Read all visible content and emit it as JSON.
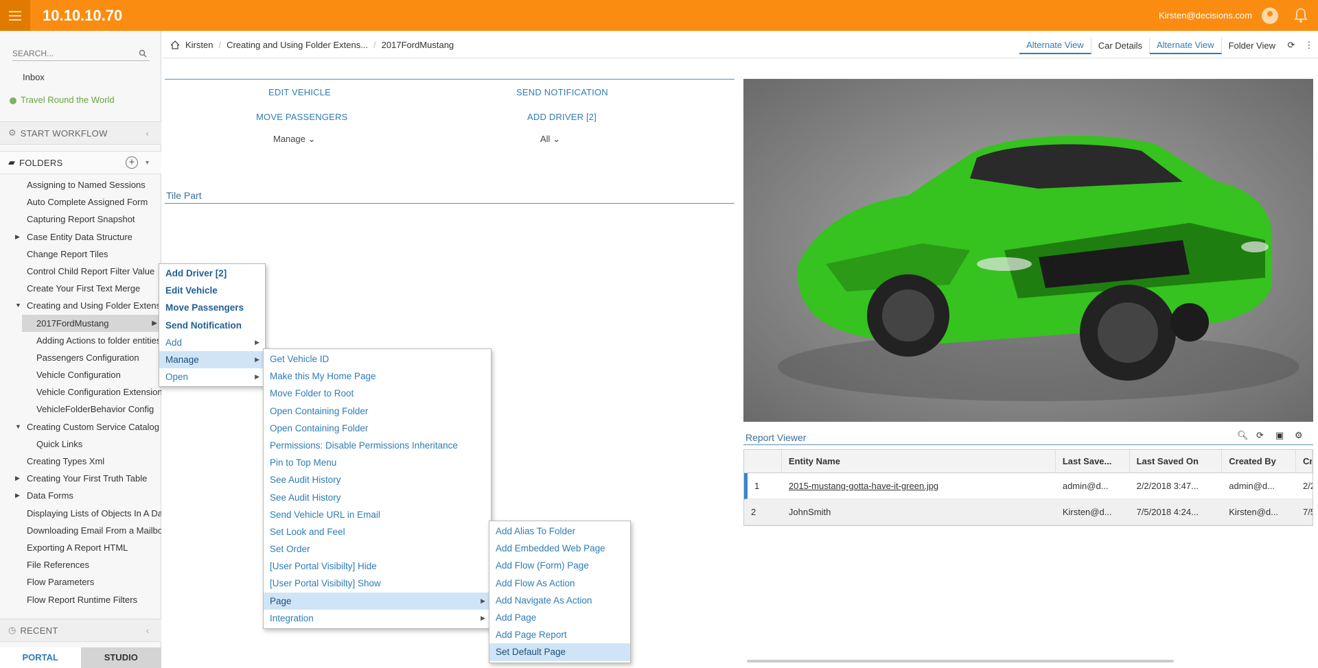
{
  "topbar": {
    "title": "10.10.10.70",
    "user": "Kirsten@decisions.com"
  },
  "sidebar": {
    "search_placeholder": "SEARCH...",
    "inbox": "Inbox",
    "travel": "Travel Round the World",
    "start_workflow": "START WORKFLOW",
    "folders": "FOLDERS",
    "tree": [
      {
        "label": "Assigning to Named Sessions",
        "indent": 0,
        "toggle": ""
      },
      {
        "label": "Auto Complete Assigned Form",
        "indent": 0,
        "toggle": ""
      },
      {
        "label": "Capturing Report Snapshot",
        "indent": 0,
        "toggle": ""
      },
      {
        "label": "Case Entity Data Structure",
        "indent": 0,
        "toggle": "▶"
      },
      {
        "label": "Change Report Tiles",
        "indent": 0,
        "toggle": ""
      },
      {
        "label": "Control Child Report Filter Value",
        "indent": 0,
        "toggle": ""
      },
      {
        "label": "Create Your First Text Merge",
        "indent": 0,
        "toggle": ""
      },
      {
        "label": "Creating and Using Folder Extensions",
        "indent": 0,
        "toggle": "▼"
      },
      {
        "label": "2017FordMustang",
        "indent": 1,
        "toggle": "",
        "selected": true
      },
      {
        "label": "Adding Actions to folder entities",
        "indent": 1,
        "toggle": ""
      },
      {
        "label": "Passengers Configuration",
        "indent": 1,
        "toggle": ""
      },
      {
        "label": "Vehicle Configuration",
        "indent": 1,
        "toggle": ""
      },
      {
        "label": "Vehicle Configuration Extension",
        "indent": 1,
        "toggle": ""
      },
      {
        "label": "VehicleFolderBehavior Config",
        "indent": 1,
        "toggle": ""
      },
      {
        "label": "Creating Custom Service Catalog",
        "indent": 0,
        "toggle": "▼"
      },
      {
        "label": "Quick Links",
        "indent": 1,
        "toggle": ""
      },
      {
        "label": "Creating Types Xml",
        "indent": 0,
        "toggle": ""
      },
      {
        "label": "Creating Your First Truth Table",
        "indent": 0,
        "toggle": "▶"
      },
      {
        "label": "Data Forms",
        "indent": 0,
        "toggle": "▶"
      },
      {
        "label": "Displaying Lists of Objects In A Data",
        "indent": 0,
        "toggle": ""
      },
      {
        "label": "Downloading Email From a Mailbox",
        "indent": 0,
        "toggle": ""
      },
      {
        "label": "Exporting A Report HTML",
        "indent": 0,
        "toggle": ""
      },
      {
        "label": "File References",
        "indent": 0,
        "toggle": ""
      },
      {
        "label": "Flow Parameters",
        "indent": 0,
        "toggle": ""
      },
      {
        "label": "Flow Report Runtime Filters",
        "indent": 0,
        "toggle": ""
      }
    ],
    "recent": "RECENT",
    "tab_portal": "PORTAL",
    "tab_studio": "STUDIO"
  },
  "breadcrumb": [
    "Kirsten",
    "Creating and Using Folder Extens...",
    "2017FordMustang"
  ],
  "views": [
    "Alternate View",
    "Car Details",
    "Alternate View",
    "Folder View"
  ],
  "actions": {
    "edit_vehicle": "EDIT VEHICLE",
    "send_notification": "SEND NOTIFICATION",
    "move_passengers": "MOVE PASSENGERS",
    "add_driver": "ADD DRIVER [2]",
    "manage": "Manage",
    "all": "All"
  },
  "tile_part": "Tile Part",
  "report": {
    "title": "Report Viewer",
    "columns": [
      "",
      "Entity Name",
      "Last Save...",
      "Last Saved On",
      "Created By",
      "Cr"
    ],
    "rows": [
      [
        "1",
        "2015-mustang-gotta-have-it-green.jpg",
        "admin@d...",
        "2/2/2018 3:47...",
        "admin@d...",
        "2/2"
      ],
      [
        "2",
        "JohnSmith",
        "Kirsten@d...",
        "7/5/2018 4:24...",
        "Kirsten@d...",
        "7/5"
      ]
    ]
  },
  "menu1": [
    {
      "label": "Add Driver [2]",
      "bold": true
    },
    {
      "label": "Edit Vehicle",
      "bold": true
    },
    {
      "label": "Move Passengers",
      "bold": true
    },
    {
      "label": "Send Notification",
      "bold": true
    },
    {
      "label": "Add",
      "sub": true
    },
    {
      "label": "Manage",
      "sub": true,
      "hl": true
    },
    {
      "label": "Open",
      "sub": true
    }
  ],
  "menu2": [
    {
      "label": "Get Vehicle ID"
    },
    {
      "label": "Make this My Home Page"
    },
    {
      "label": "Move Folder to Root"
    },
    {
      "label": "Open Containing Folder"
    },
    {
      "label": "Open Containing Folder"
    },
    {
      "label": "Permissions: Disable Permissions Inheritance"
    },
    {
      "label": "Pin to Top Menu"
    },
    {
      "label": "See Audit History"
    },
    {
      "label": "See Audit History"
    },
    {
      "label": "Send Vehicle URL in Email"
    },
    {
      "label": "Set Look and Feel"
    },
    {
      "label": "Set Order"
    },
    {
      "label": "[User Portal Visibilty] Hide"
    },
    {
      "label": "[User Portal Visibilty] Show"
    },
    {
      "label": "Page",
      "sub": true,
      "hl": true
    },
    {
      "label": "Integration",
      "sub": true
    }
  ],
  "menu3": [
    {
      "label": "Add Alias To Folder"
    },
    {
      "label": "Add Embedded Web Page"
    },
    {
      "label": "Add Flow (Form) Page"
    },
    {
      "label": "Add Flow As Action"
    },
    {
      "label": "Add Navigate As Action"
    },
    {
      "label": "Add Page"
    },
    {
      "label": "Add Page Report"
    },
    {
      "label": "Set Default Page",
      "hl": true
    }
  ],
  "colors": {
    "topbar": "#fb8c12",
    "link": "#2e7cb5",
    "car": "#35c31f"
  }
}
